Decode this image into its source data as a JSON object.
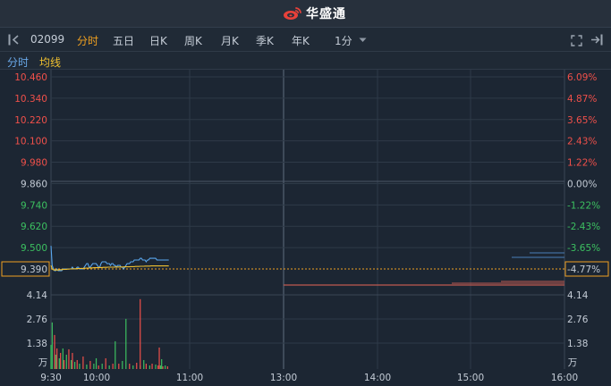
{
  "brand": {
    "name": "华盛通",
    "logo_color": "#e8413a"
  },
  "toolbar": {
    "code": "02099",
    "tabs": [
      {
        "label": "分时",
        "active": true
      },
      {
        "label": "五日",
        "active": false
      },
      {
        "label": "日K",
        "active": false
      },
      {
        "label": "周K",
        "active": false
      },
      {
        "label": "月K",
        "active": false
      },
      {
        "label": "季K",
        "active": false
      },
      {
        "label": "年K",
        "active": false
      }
    ],
    "interval": "1分"
  },
  "subbar": {
    "line1": "分时",
    "line2": "均线"
  },
  "chart_data": {
    "type": "line",
    "price_axis": {
      "ticks": [
        "10.460",
        "10.340",
        "10.220",
        "10.100",
        "9.980",
        "9.860",
        "9.740",
        "9.620",
        "9.500",
        "9.390"
      ],
      "prev_close": 9.86,
      "ylim": [
        9.38,
        10.46
      ]
    },
    "pct_axis": {
      "ticks": [
        "6.09%",
        "4.87%",
        "3.65%",
        "2.43%",
        "1.22%",
        "0.00%",
        "-1.22%",
        "-2.43%",
        "-3.65%",
        "-4.77%"
      ]
    },
    "current_price_label": "9.390",
    "current_pct_label": "-4.77%",
    "volume_axis": {
      "ticks": [
        "4.14",
        "2.76",
        "1.38"
      ],
      "unit": "万",
      "max": 4.14
    },
    "time_axis": [
      "9:30",
      "10:00",
      "11:00",
      "13:00",
      "14:00",
      "15:00",
      "16:00"
    ],
    "series": [
      {
        "values": [
          9.51,
          9.4,
          9.38,
          9.37,
          9.37,
          9.38,
          9.37,
          9.37,
          9.37,
          9.37,
          9.38,
          9.38,
          9.38,
          9.38,
          9.38,
          9.38,
          9.38,
          9.38,
          9.39,
          9.38,
          9.38,
          9.38,
          9.39,
          9.39,
          9.38,
          9.38,
          9.38,
          9.38,
          9.39,
          9.4,
          9.41,
          9.41,
          9.39,
          9.39,
          9.4,
          9.41,
          9.41,
          9.41,
          9.41,
          9.4,
          9.39,
          9.39,
          9.41,
          9.42,
          9.42,
          9.42,
          9.42,
          9.41,
          9.41,
          9.41,
          9.4,
          9.41,
          9.41,
          9.4,
          9.4,
          9.39,
          9.4,
          9.4,
          9.4,
          9.39,
          9.39,
          9.38,
          9.39,
          9.4,
          9.41,
          9.41,
          9.41,
          9.42,
          9.42,
          9.42,
          9.43,
          9.43,
          9.43,
          9.43,
          9.43,
          9.44,
          9.44,
          9.43,
          9.43,
          9.43,
          9.42,
          9.43,
          9.43,
          9.44,
          9.44,
          9.44,
          9.44,
          9.44,
          9.44,
          9.43,
          9.43,
          9.43,
          9.43,
          9.43,
          9.43,
          9.43,
          9.43,
          9.43,
          9.43,
          9.43
        ],
        "color": "#5aa8f0"
      },
      {
        "values": [
          9.4,
          9.38,
          9.375,
          9.374,
          9.374,
          9.374,
          9.374,
          9.375,
          9.376,
          9.376,
          9.377,
          9.378,
          9.378,
          9.378,
          9.379,
          9.379,
          9.38,
          9.38,
          9.38,
          9.381,
          9.381,
          9.381,
          9.382,
          9.382,
          9.382,
          9.383,
          9.383,
          9.383,
          9.384,
          9.384,
          9.385,
          9.385,
          9.385,
          9.386,
          9.386,
          9.386,
          9.387,
          9.387,
          9.387,
          9.387,
          9.388,
          9.388,
          9.388,
          9.388,
          9.389,
          9.389,
          9.389,
          9.389,
          9.39,
          9.39,
          9.39,
          9.39,
          9.39,
          9.39,
          9.391,
          9.391,
          9.391,
          9.391,
          9.391,
          9.391,
          9.391,
          9.391,
          9.392,
          9.392,
          9.392,
          9.392,
          9.392,
          9.393,
          9.393,
          9.393,
          9.393,
          9.394,
          9.394,
          9.394,
          9.394,
          9.395,
          9.395,
          9.395,
          9.395,
          9.396,
          9.396,
          9.396,
          9.396,
          9.396,
          9.397,
          9.397,
          9.397,
          9.397,
          9.397,
          9.397,
          9.397,
          9.397,
          9.397,
          9.397,
          9.397,
          9.397,
          9.397,
          9.397,
          9.397,
          9.397
        ],
        "color": "#f0c030"
      }
    ],
    "volume_bars": [
      {
        "i": 0,
        "v": 1.35,
        "c": "g"
      },
      {
        "i": 1,
        "v": 2.6,
        "c": "g"
      },
      {
        "i": 3,
        "v": 1.9,
        "c": "r"
      },
      {
        "i": 4,
        "v": 0.8,
        "c": "g"
      },
      {
        "i": 5,
        "v": 1.15,
        "c": "r"
      },
      {
        "i": 7,
        "v": 0.6,
        "c": "g"
      },
      {
        "i": 8,
        "v": 0.9,
        "c": "r"
      },
      {
        "i": 10,
        "v": 1.15,
        "c": "g"
      },
      {
        "i": 11,
        "v": 0.5,
        "c": "r"
      },
      {
        "i": 13,
        "v": 0.8,
        "c": "g"
      },
      {
        "i": 15,
        "v": 1.1,
        "c": "r"
      },
      {
        "i": 17,
        "v": 0.5,
        "c": "g"
      },
      {
        "i": 18,
        "v": 0.9,
        "c": "r"
      },
      {
        "i": 20,
        "v": 0.4,
        "c": "g"
      },
      {
        "i": 22,
        "v": 0.5,
        "c": "r"
      },
      {
        "i": 24,
        "v": 0.3,
        "c": "g"
      },
      {
        "i": 27,
        "v": 0.7,
        "c": "r"
      },
      {
        "i": 30,
        "v": 0.25,
        "c": "g"
      },
      {
        "i": 33,
        "v": 0.45,
        "c": "r"
      },
      {
        "i": 36,
        "v": 0.3,
        "c": "g"
      },
      {
        "i": 38,
        "v": 0.6,
        "c": "g"
      },
      {
        "i": 40,
        "v": 0.2,
        "c": "r"
      },
      {
        "i": 43,
        "v": 0.3,
        "c": "g"
      },
      {
        "i": 46,
        "v": 0.6,
        "c": "r"
      },
      {
        "i": 49,
        "v": 0.2,
        "c": "g"
      },
      {
        "i": 52,
        "v": 0.3,
        "c": "r"
      },
      {
        "i": 54,
        "v": 1.55,
        "c": "g"
      },
      {
        "i": 57,
        "v": 0.3,
        "c": "r"
      },
      {
        "i": 60,
        "v": 0.45,
        "c": "g"
      },
      {
        "i": 63,
        "v": 2.8,
        "c": "g"
      },
      {
        "i": 66,
        "v": 0.3,
        "c": "r"
      },
      {
        "i": 69,
        "v": 0.2,
        "c": "g"
      },
      {
        "i": 72,
        "v": 0.35,
        "c": "r"
      },
      {
        "i": 75,
        "v": 0.2,
        "c": "g"
      },
      {
        "i": 78,
        "v": 0.5,
        "c": "g"
      },
      {
        "i": 80,
        "v": 0.3,
        "c": "r"
      },
      {
        "i": 83,
        "v": 0.2,
        "c": "g"
      },
      {
        "i": 85,
        "v": 0.3,
        "c": "r"
      },
      {
        "i": 88,
        "v": 0.25,
        "c": "g"
      },
      {
        "i": 90,
        "v": 0.2,
        "c": "r"
      },
      {
        "i": 92,
        "v": 0.2,
        "c": "g"
      },
      {
        "i": 94,
        "v": 0.15,
        "c": "r"
      },
      {
        "i": 96,
        "v": 0.2,
        "c": "g"
      },
      {
        "i": 98,
        "v": 0.15,
        "c": "r"
      }
    ],
    "volume_extra": [
      {
        "i": 75,
        "v": 3.9,
        "c": "r"
      },
      {
        "i": 91,
        "v": 1.2,
        "c": "r"
      },
      {
        "i": 93,
        "v": 0.55,
        "c": "g"
      }
    ],
    "colors": {
      "up": "#f0504a",
      "down": "#3cc060",
      "neutral": "#c4ccd6",
      "grid": "#2e3a48",
      "highlight": "#f0a020"
    }
  }
}
